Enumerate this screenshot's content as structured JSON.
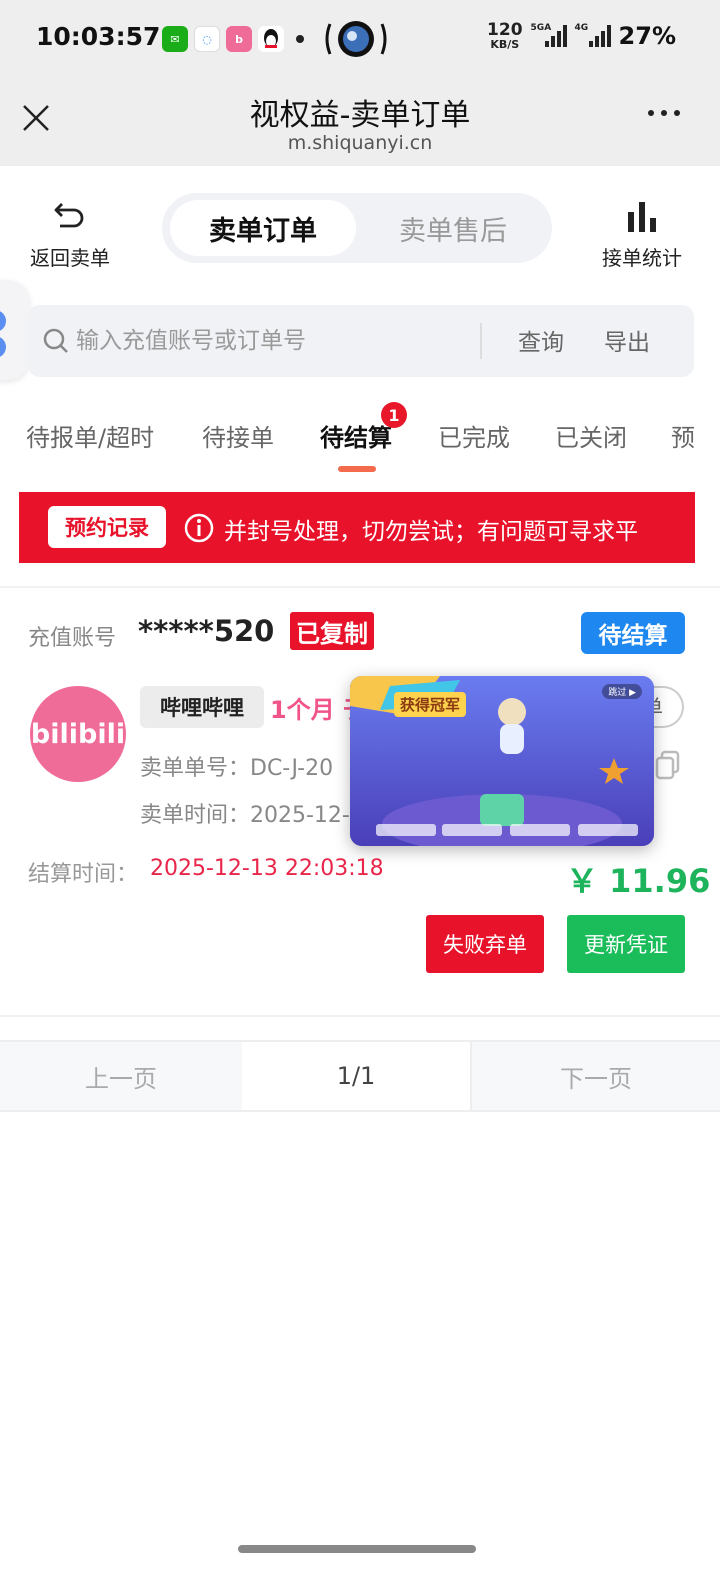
{
  "status_bar": {
    "time": "10:03:57",
    "net_speed_value": "120",
    "net_speed_unit": "KB/S",
    "signal1_label": "5GA",
    "signal2_label": "4G",
    "battery": "27%"
  },
  "browser": {
    "title": "视权益-卖单订单",
    "url": "m.shiquanyi.cn"
  },
  "top_nav": {
    "back_label": "返回卖单",
    "segments": [
      "卖单订单",
      "卖单售后"
    ],
    "active_segment": 0,
    "stats_label": "接单统计"
  },
  "search": {
    "placeholder": "输入充值账号或订单号",
    "value": "",
    "query_label": "查询",
    "export_label": "导出"
  },
  "tabs": {
    "items": [
      "待报单/超时",
      "待接单",
      "待结算",
      "已完成",
      "已关闭",
      "预"
    ],
    "active": 2,
    "badge": "1"
  },
  "notice": {
    "tag": "预约记录",
    "text": "并封号处理，切勿尝试；有问题可寻求平"
  },
  "order": {
    "account_label": "充值账号",
    "account_value": "*****520",
    "copied_label": "已复制",
    "status": "待结算",
    "logo_text": "bilibili",
    "platform": "哔哩哔哩",
    "product": "1个月 ",
    "product_tail": "于",
    "order_no": "卖单单号：DC-J-20",
    "order_time": "卖单时间：2025-12-",
    "right_pill": "单",
    "settle_label": "结算时间：",
    "settle_time": "2025-12-13 22:03:18",
    "amount": "￥ 11.96",
    "fail_button": "失败弃单",
    "update_button": "更新凭证"
  },
  "pip": {
    "banner": "获得冠军",
    "skip": "跳过 ▶"
  },
  "pagination": {
    "prev": "上一页",
    "current": "1/1",
    "next": "下一页"
  },
  "colors": {
    "red": "#e8122a",
    "blue": "#1e88f0",
    "green": "#1bbd5a",
    "pink": "#f06c98",
    "tab_underline": "#f36b4c"
  }
}
